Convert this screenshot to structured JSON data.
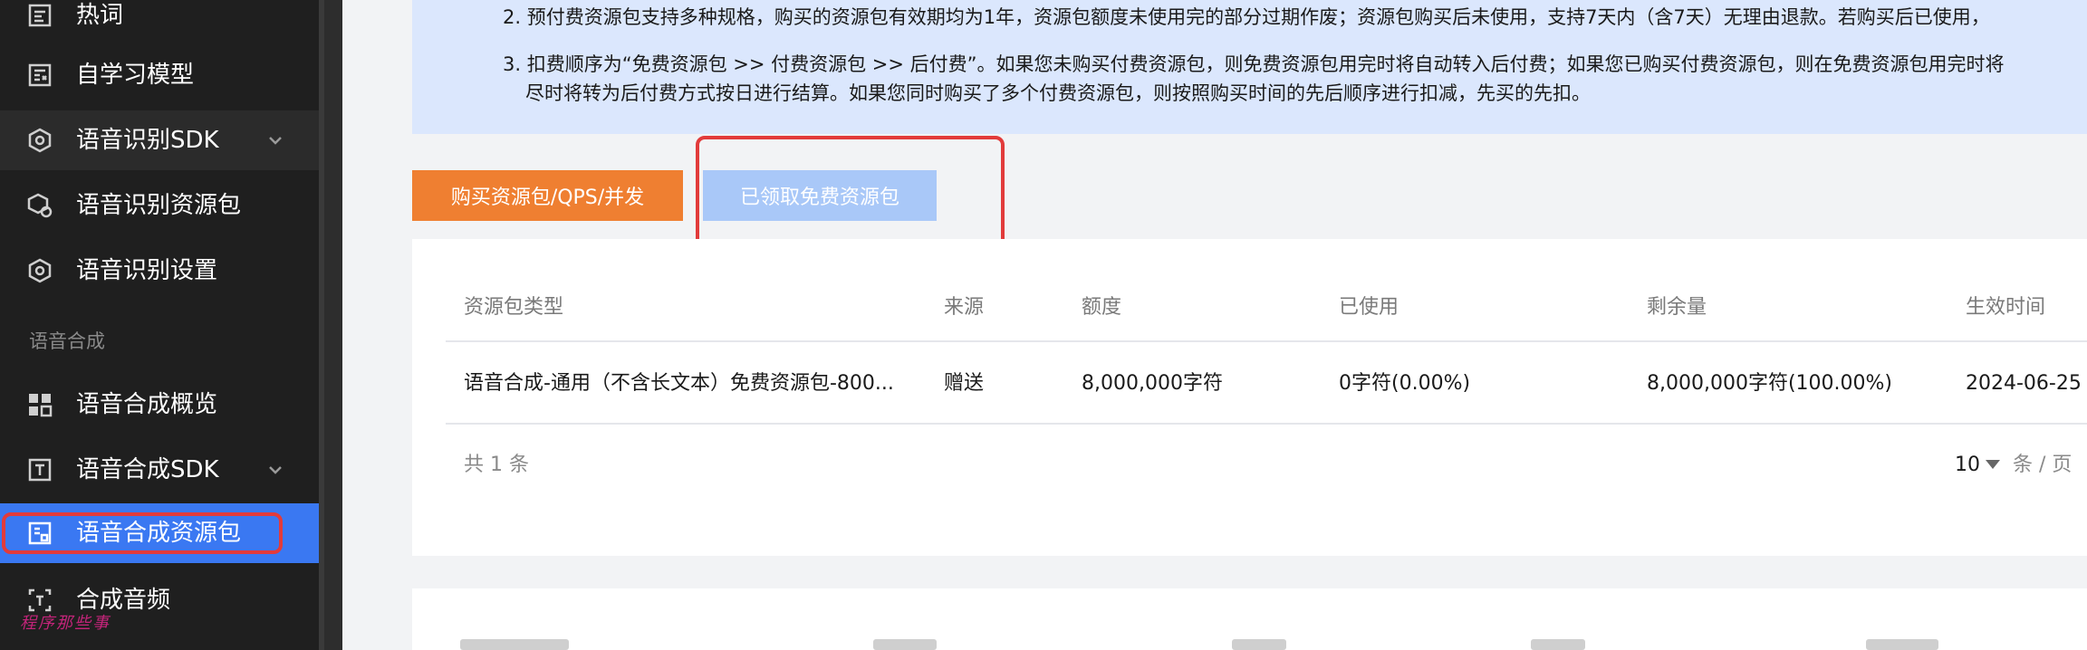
{
  "sidebar": {
    "items": [
      {
        "label": "热词",
        "icon": "hotword-icon"
      },
      {
        "label": "自学习模型",
        "icon": "model-icon"
      },
      {
        "label": "语音识别SDK",
        "icon": "sdk-icon",
        "expandable": true
      },
      {
        "label": "语音识别资源包",
        "icon": "package-icon"
      },
      {
        "label": "语音识别设置",
        "icon": "settings-icon"
      }
    ],
    "group_label": "语音合成",
    "group_items": [
      {
        "label": "语音合成概览",
        "icon": "overview-icon"
      },
      {
        "label": "语音合成SDK",
        "icon": "tts-sdk-icon",
        "expandable": true
      },
      {
        "label": "语音合成资源包",
        "icon": "tts-package-icon",
        "active": true
      },
      {
        "label": "合成音频",
        "icon": "audio-icon"
      }
    ],
    "watermark": "程序那些事"
  },
  "notice": {
    "line2": "2. 预付费资源包支持多种规格，购买的资源包有效期均为1年，资源包额度未使用完的部分过期作废；资源包购买后未使用，支持7天内（含7天）无理由退款。若购买后已使用，",
    "line3a": "3. 扣费顺序为“免费资源包 >> 付费资源包 >> 后付费”。如果您未购买付费资源包，则免费资源包用完时将自动转入后付费；如果您已购买付费资源包，则在免费资源包用完时将",
    "line3b": "尽时将转为后付费方式按日进行结算。如果您同时购买了多个付费资源包，则按照购买时间的先后顺序进行扣减，先买的先扣。"
  },
  "actions": {
    "buy_label": "购买资源包/QPS/并发",
    "free_label": "已领取免费资源包"
  },
  "table": {
    "headers": [
      "资源包类型",
      "来源",
      "额度",
      "已使用",
      "剩余量",
      "生效时间"
    ],
    "rows": [
      [
        "语音合成-通用（不含长文本）免费资源包-800...",
        "赠送",
        "8,000,000字符",
        "0字符(0.00%)",
        "8,000,000字符(100.00%)",
        "2024-06-25"
      ]
    ],
    "total": "共 1 条",
    "page_size": "10",
    "page_unit": "条 / 页"
  },
  "colors": {
    "sidebar_bg": "#1f1f1f",
    "active": "#3a78f2",
    "buy_button": "#ef7f31",
    "free_button": "#a9c8f8",
    "notice_bg": "#dbe7fd",
    "highlight_outline": "#e23b3b"
  }
}
